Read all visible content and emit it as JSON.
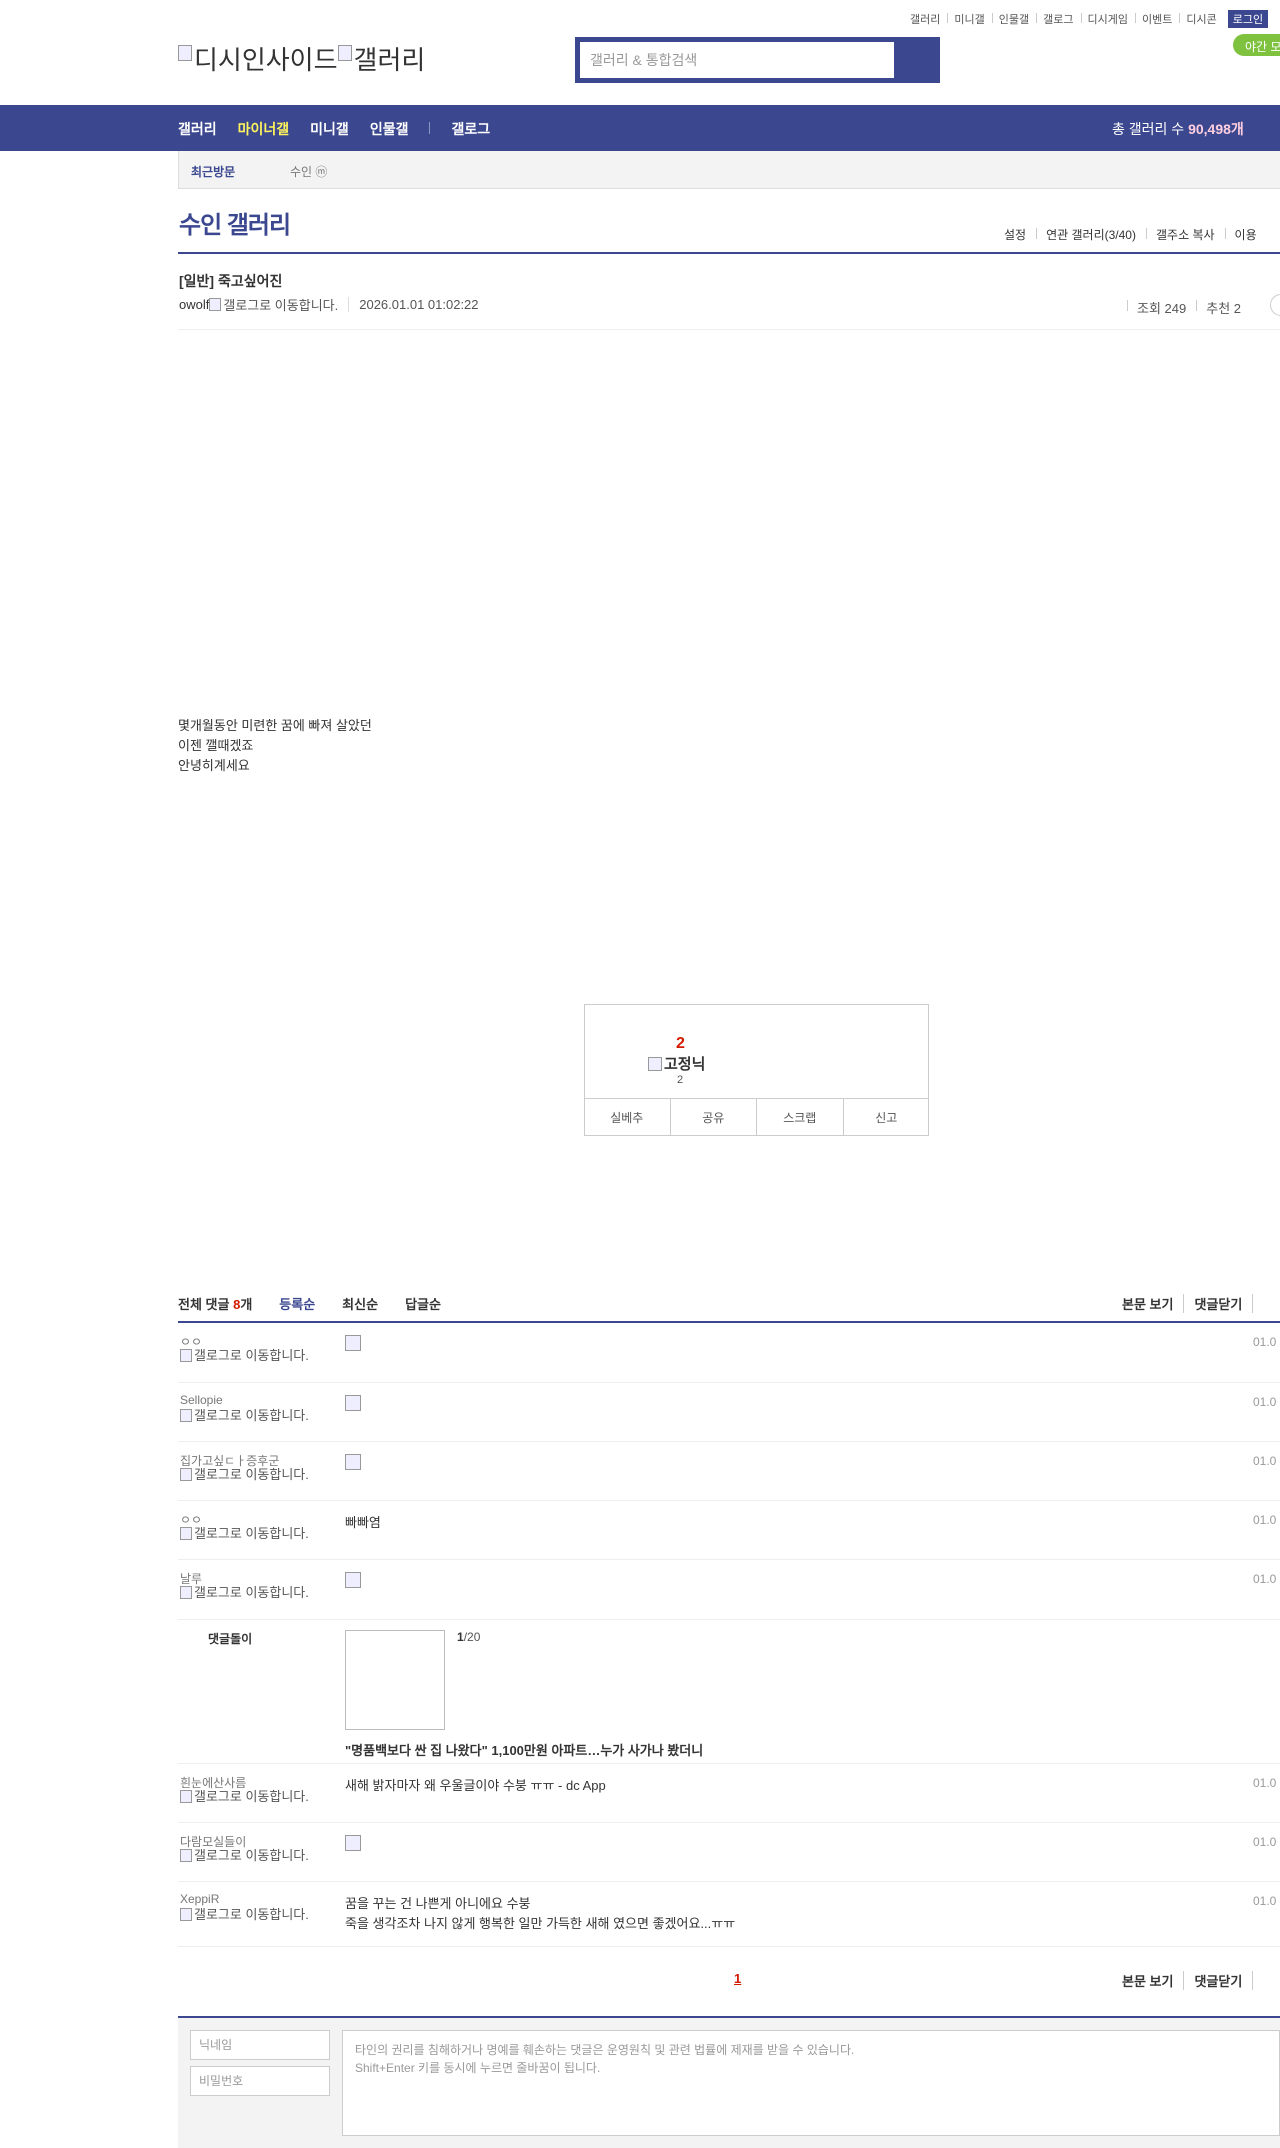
{
  "util": [
    "갤러리",
    "미니갤",
    "인물갤",
    "갤로그",
    "디시게임",
    "이벤트",
    "디시콘"
  ],
  "login": "로그인",
  "night_mode": "야간 모",
  "logo": {
    "dc": "디시인사이드",
    "gallery": "갤러리"
  },
  "search": {
    "placeholder": "갤러리 & 통합검색"
  },
  "gnb": {
    "items": [
      "갤러리",
      "마이너갤",
      "미니갤",
      "인물갤"
    ],
    "gallog": "갤로그",
    "total_label": "총 갤러리 수",
    "total_value": "90,498개"
  },
  "recent": {
    "label": "최근방문",
    "gallery": "수인 ⓜ"
  },
  "gallery": {
    "title": "수인 갤러리",
    "menu": [
      "설정",
      "연관 갤러리(3/40)",
      "갤주소 복사",
      "이용"
    ]
  },
  "post": {
    "title": "[일반] 죽고싶어진",
    "author": "owolf",
    "gallog_alt": "갤로그로 이동합니다.",
    "date": "2026.01.01 01:02:22",
    "views": "조회 249",
    "recommends": "추천 2",
    "body": [
      "몇개월동안 미련한 꿈에 빠져 살았던",
      "이젠 깰때겠죠",
      "안녕히계세요"
    ]
  },
  "recommend": {
    "up_count": "2",
    "fix_name": "고정닉",
    "fix_count": "2",
    "buttons": [
      "실베추",
      "공유",
      "스크랩",
      "신고"
    ]
  },
  "comments": {
    "total_prefix": "전체 댓글",
    "total_count": "8",
    "total_suffix": "개",
    "sort": [
      "등록순",
      "최신순",
      "답글순"
    ],
    "actions": [
      "본문 보기",
      "댓글닫기"
    ],
    "gallog_alt": "갤로그로 이동합니다.",
    "items": [
      {
        "nick": "ㅇㅇ",
        "text": "",
        "dccon": true,
        "date": "01.0"
      },
      {
        "nick": "Sellopie",
        "text": "",
        "dccon": true,
        "date": "01.0"
      },
      {
        "nick": "집가고싶ㄷㅏ증후군",
        "text": "",
        "dccon": true,
        "date": "01.0"
      },
      {
        "nick": "ㅇㅇ",
        "text": "빠빠염",
        "dccon": false,
        "date": "01.0"
      },
      {
        "nick": "날루",
        "text": "",
        "dccon": true,
        "date": "01.0"
      },
      {
        "nick": "흰눈에산사름",
        "text": "새해 밝자마자 왜 우울글이야 수붕 ㅠㅠ - dc App",
        "dccon": false,
        "date": "01.0"
      },
      {
        "nick": "다람모실들이",
        "text": "",
        "dccon": true,
        "date": "01.0"
      },
      {
        "nick": "XeppiR",
        "text": "꿈을 꾸는 건 나쁜게 아니에요 수붕",
        "text2": "죽을 생각조차 나지 않게 행복한 일만 가득한 새해 였으면 좋겠어요...ㅠㅠ",
        "dccon": false,
        "date": "01.0"
      }
    ],
    "reply_ad": {
      "who": "댓글돌이",
      "page_current": "1",
      "page_total": "/20",
      "headline": "\"명품백보다 싼 집 나왔다\" 1,100만원 아파트…누가 사가나 봤더니"
    },
    "pager": "1"
  },
  "write": {
    "nick_placeholder": "닉네임",
    "pw_placeholder": "비밀번호",
    "text_placeholder": "타인의 권리를 침해하거나 명예를 훼손하는 댓글은 운영원칙 및 관련 법률에 제재를 받을 수 있습니다.\nShift+Enter 키를 동시에 누르면 줄바꿈이 됩니다."
  },
  "colors": {
    "brand": "#3b4890",
    "accent_red": "#d31900",
    "gnb_active": "#fff45c",
    "night": "#7ec240"
  }
}
